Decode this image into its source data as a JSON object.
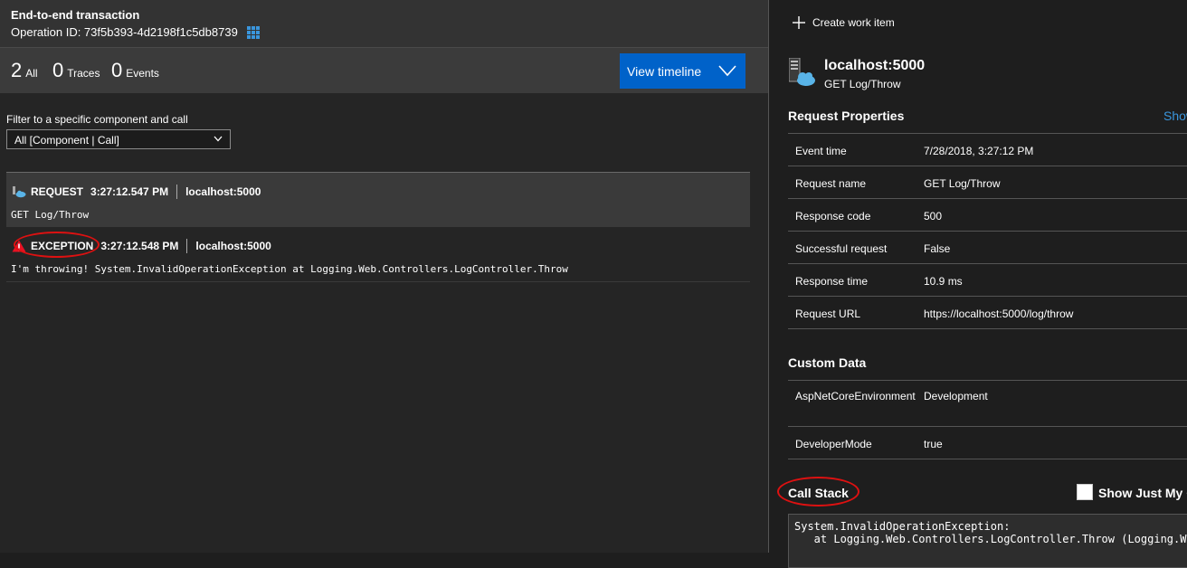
{
  "header": {
    "title": "End-to-end transaction",
    "operation_id_label": "Operation ID: 73f5b393-4d2198f1c5db8739"
  },
  "counts": {
    "all_num": "2",
    "all_label": "All",
    "traces_num": "0",
    "traces_label": "Traces",
    "events_num": "0",
    "events_label": "Events"
  },
  "view_timeline_label": "View timeline",
  "filter": {
    "label": "Filter to a specific component and call",
    "value": "All [Component | Call]"
  },
  "rows": [
    {
      "type": "REQUEST",
      "time": "3:27:12.547 PM",
      "host": "localhost:5000",
      "detail": "GET Log/Throw"
    },
    {
      "type": "EXCEPTION",
      "time": "3:27:12.548 PM",
      "host": "localhost:5000",
      "detail": "I'm throwing! System.InvalidOperationException at Logging.Web.Controllers.LogController.Throw"
    }
  ],
  "right": {
    "create_work_item": "Create work item",
    "host": "localhost:5000",
    "host_sub": "GET Log/Throw",
    "request_properties_title": "Request Properties",
    "show_link": "Show",
    "request_properties": [
      {
        "key": "Event time",
        "value": "7/28/2018, 3:27:12 PM"
      },
      {
        "key": "Request name",
        "value": "GET Log/Throw"
      },
      {
        "key": "Response code",
        "value": "500"
      },
      {
        "key": "Successful request",
        "value": "False"
      },
      {
        "key": "Response time",
        "value": "10.9 ms"
      },
      {
        "key": "Request URL",
        "value": "https://localhost:5000/log/throw"
      }
    ],
    "custom_data_title": "Custom Data",
    "custom_data": [
      {
        "key": "AspNetCoreEnvironment",
        "value": "Development"
      },
      {
        "key": "DeveloperMode",
        "value": "true"
      }
    ],
    "call_stack_title": "Call Stack",
    "show_just_my_code": "Show Just My C",
    "call_stack_text": "System.InvalidOperationException:\n   at Logging.Web.Controllers.LogController.Throw (Logging.Web"
  },
  "colors": {
    "accent": "#0062c9",
    "link": "#3a96dd",
    "highlight_oval": "#dd1111",
    "warning": "#e81123"
  }
}
